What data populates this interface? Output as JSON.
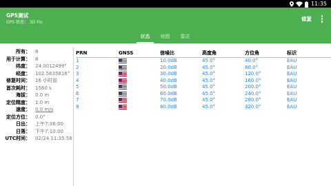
{
  "status_bar": {
    "time": "11:35",
    "icons": [
      "location-icon",
      "wifi-icon",
      "battery-icon"
    ]
  },
  "app_bar": {
    "title": "GPS测试",
    "subtitle": "GPS 状态： 3D Fix",
    "action_label": "修复",
    "overflow_icon": "more-vert-icon",
    "color": "#4caf50"
  },
  "tabs": [
    {
      "label": "状态",
      "active": true
    },
    {
      "label": "地图",
      "active": false
    },
    {
      "label": "雷达",
      "active": false
    }
  ],
  "status": [
    {
      "key": "所有：",
      "value": "8"
    },
    {
      "key": "用于计算：",
      "value": "8"
    },
    {
      "key": "纬度：",
      "value": "24.0012499°"
    },
    {
      "key": "经度：",
      "value": "102.5635816°"
    },
    {
      "key": "修复时间：",
      "value": "16 小时前"
    },
    {
      "key": "首次耗时：",
      "value": "1560 s"
    },
    {
      "key": "海拔：",
      "value": "0.0 m"
    },
    {
      "key": "定位精度：",
      "value": "1.0 m"
    },
    {
      "key": "速度：",
      "value": "0.0 m/s"
    },
    {
      "key": "定位方位：",
      "value": "0.0°"
    },
    {
      "key": "日出：",
      "value": "上午7:36:00"
    },
    {
      "key": "日落：",
      "value": "下午7:10:00"
    },
    {
      "key": "UTC时间：",
      "value": "02/24 11:35:58"
    }
  ],
  "satellite_table": {
    "headers": [
      "PRN",
      "GNSS",
      "信噪比",
      "高度角",
      "方位角",
      "标识"
    ],
    "gnss_icon": "us-flag-icon",
    "rows": [
      {
        "prn": "1",
        "snr": "10.0dB",
        "elevation": "45.0°",
        "azimuth": "40.0°",
        "flags": "EAU"
      },
      {
        "prn": "2",
        "snr": "20.0dB",
        "elevation": "45.0°",
        "azimuth": "80.0°",
        "flags": "EAU"
      },
      {
        "prn": "3",
        "snr": "30.0dB",
        "elevation": "45.0°",
        "azimuth": "120.0°",
        "flags": "EAU"
      },
      {
        "prn": "4",
        "snr": "40.0dB",
        "elevation": "45.0°",
        "azimuth": "160.0°",
        "flags": "EAU"
      },
      {
        "prn": "5",
        "snr": "50.0dB",
        "elevation": "45.0°",
        "azimuth": "200.0°",
        "flags": "EAU"
      },
      {
        "prn": "6",
        "snr": "60.0dB",
        "elevation": "45.0°",
        "azimuth": "240.0°",
        "flags": "EAU"
      },
      {
        "prn": "7",
        "snr": "70.0dB",
        "elevation": "45.0°",
        "azimuth": "280.0°",
        "flags": "EAU"
      },
      {
        "prn": "8",
        "snr": "80.0dB",
        "elevation": "45.0°",
        "azimuth": "320.0°",
        "flags": "EAU"
      }
    ],
    "value_color": "#1e88e5"
  }
}
